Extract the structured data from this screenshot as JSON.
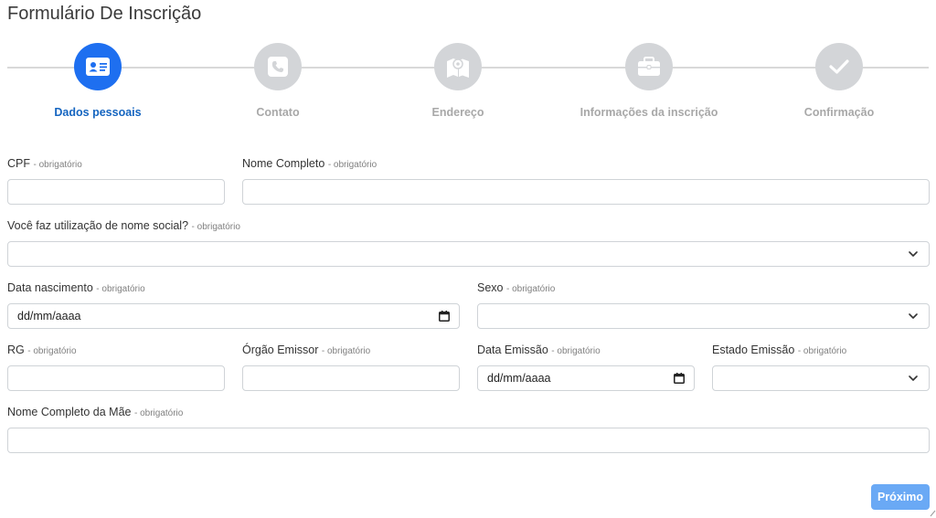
{
  "page": {
    "title": "Formulário De Inscrição"
  },
  "stepper": {
    "steps": [
      {
        "label": "Dados pessoais",
        "icon": "id-card-icon",
        "active": true
      },
      {
        "label": "Contato",
        "icon": "phone-icon",
        "active": false
      },
      {
        "label": "Endereço",
        "icon": "map-icon",
        "active": false
      },
      {
        "label": "Informações da inscrição",
        "icon": "briefcase-icon",
        "active": false
      },
      {
        "label": "Confirmação",
        "icon": "check-icon",
        "active": false
      }
    ]
  },
  "form": {
    "required_hint": "- obrigatório",
    "cpf": {
      "label": "CPF",
      "value": ""
    },
    "nome_completo": {
      "label": "Nome Completo",
      "value": ""
    },
    "nome_social": {
      "label": "Você faz utilização de nome social?",
      "value": ""
    },
    "data_nascimento": {
      "label": "Data nascimento",
      "placeholder": "dd/mm/aaaa"
    },
    "sexo": {
      "label": "Sexo",
      "value": ""
    },
    "rg": {
      "label": "RG",
      "value": ""
    },
    "orgao_emissor": {
      "label": "Órgão Emissor",
      "value": ""
    },
    "data_emissao": {
      "label": "Data Emissão",
      "placeholder": "dd/mm/aaaa"
    },
    "estado_emissao": {
      "label": "Estado Emissão",
      "value": ""
    },
    "nome_mae": {
      "label": "Nome Completo da Mãe",
      "value": ""
    }
  },
  "actions": {
    "next_label": "Próximo"
  },
  "colors": {
    "primary": "#1e6ff0",
    "active_label": "#1565c0",
    "inactive_step": "#d3d5d8",
    "next_button": "#6aa9f5"
  }
}
